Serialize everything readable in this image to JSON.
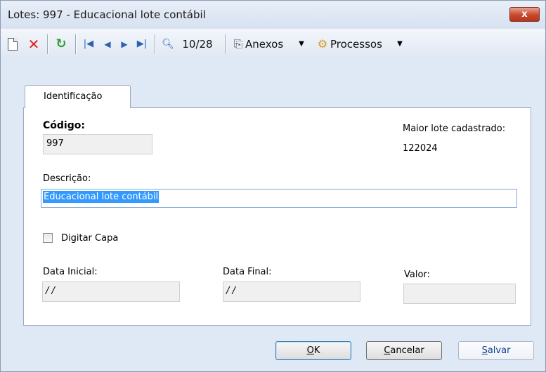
{
  "window": {
    "title": "Lotes: 997 - Educacional lote contábil",
    "close_label": "x"
  },
  "toolbar": {
    "record_counter": "10/28",
    "anexos_label": "Anexos",
    "processos_label": "Processos"
  },
  "tabs": [
    {
      "label": "Identificação",
      "active": true
    }
  ],
  "form": {
    "codigo_label": "Código:",
    "codigo_value": "997",
    "maior_lote_label": "Maior lote cadastrado:",
    "maior_lote_value": "122024",
    "descricao_label": "Descrição:",
    "descricao_value": "Educacional lote contábil",
    "digitar_capa_label": "Digitar Capa",
    "digitar_capa_checked": false,
    "data_inicial_label": "Data Inicial:",
    "data_inicial_value": "/ /",
    "data_final_label": "Data Final:",
    "data_final_value": "/ /",
    "valor_label": "Valor:",
    "valor_value": ""
  },
  "buttons": {
    "ok_mnemonic": "O",
    "ok_rest": "K",
    "cancelar_mnemonic": "C",
    "cancelar_rest": "ancelar",
    "salvar_mnemonic": "S",
    "salvar_rest": "alvar"
  },
  "colors": {
    "accent": "#3399ff",
    "close": "#c7472c",
    "delete_icon": "#e02020",
    "refresh_icon": "#2e9a2e",
    "nav_icon": "#2f5fb3"
  }
}
